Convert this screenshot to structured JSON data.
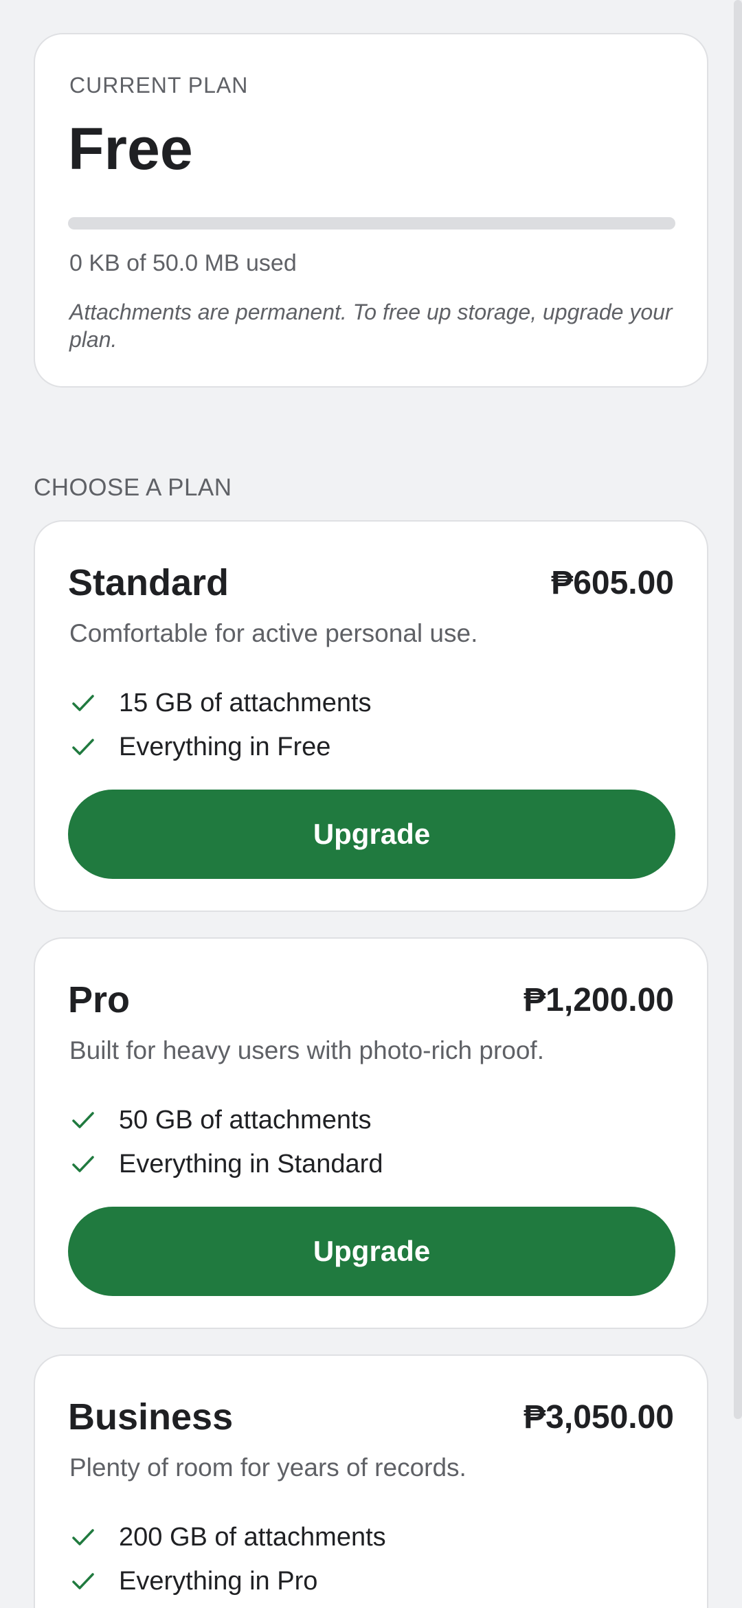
{
  "current_plan": {
    "label": "CURRENT PLAN",
    "name": "Free",
    "usage_fraction": 0,
    "usage_text": "0 KB of 50.0 MB used",
    "note": "Attachments are permanent. To free up storage, upgrade your plan."
  },
  "choose_heading": "CHOOSE A PLAN",
  "plans": [
    {
      "name": "Standard",
      "price": "₱605.00",
      "description": "Comfortable for active personal use.",
      "features": [
        "15 GB of attachments",
        "Everything in Free"
      ],
      "button_label": "Upgrade"
    },
    {
      "name": "Pro",
      "price": "₱1,200.00",
      "description": "Built for heavy users with photo-rich proof.",
      "features": [
        "50 GB of attachments",
        "Everything in Standard"
      ],
      "button_label": "Upgrade"
    },
    {
      "name": "Business",
      "price": "₱3,050.00",
      "description": "Plenty of room for years of records.",
      "features": [
        "200 GB of attachments",
        "Everything in Pro"
      ]
    }
  ],
  "icons": {
    "check": "check-icon",
    "status": [
      "tiktok-icon",
      "tiktok-icon",
      "globe-icon"
    ]
  },
  "colors": {
    "accent": "#207a3f",
    "background": "#f1f2f4",
    "card": "#ffffff",
    "muted_text": "#5f6166"
  }
}
